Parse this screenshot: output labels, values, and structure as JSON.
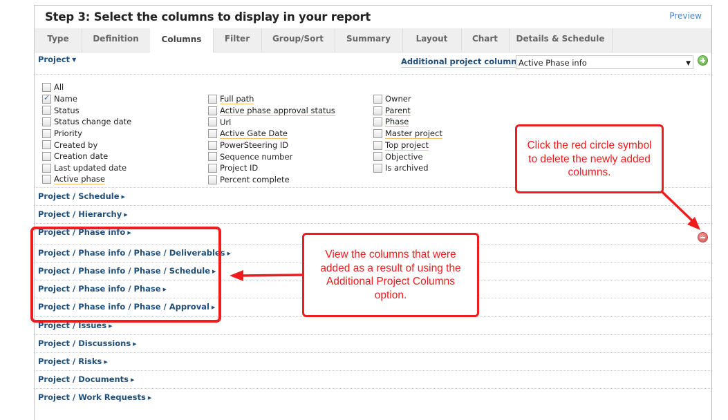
{
  "header": {
    "title": "Step 3: Select the columns to display in your report",
    "preview_label": "Preview"
  },
  "tabs": [
    {
      "label": "Type",
      "active": false
    },
    {
      "label": "Definition",
      "active": false
    },
    {
      "label": "Columns",
      "active": true
    },
    {
      "label": "Filter",
      "active": false
    },
    {
      "label": "Group/Sort",
      "active": false
    },
    {
      "label": "Summary",
      "active": false
    },
    {
      "label": "Layout",
      "active": false
    },
    {
      "label": "Chart",
      "active": false
    },
    {
      "label": "Details & Schedule",
      "active": false
    }
  ],
  "project_section": {
    "label": "Project",
    "additional_columns_label": "Additional project columns :",
    "additional_columns_value": "Active Phase info",
    "add_icon": "plus-circle-icon"
  },
  "checkbox_columns": [
    [
      {
        "label": "All",
        "checked": false,
        "underlined": false
      },
      {
        "label": "Name",
        "checked": true,
        "underlined": false
      },
      {
        "label": "Status",
        "checked": false,
        "underlined": false
      },
      {
        "label": "Status change date",
        "checked": false,
        "underlined": false
      },
      {
        "label": "Priority",
        "checked": false,
        "underlined": false
      },
      {
        "label": "Created by",
        "checked": false,
        "underlined": false
      },
      {
        "label": "Creation date",
        "checked": false,
        "underlined": false
      },
      {
        "label": "Last updated date",
        "checked": false,
        "underlined": false
      },
      {
        "label": "Active phase",
        "checked": false,
        "underlined": true
      }
    ],
    [
      {
        "label": "Full path",
        "checked": false,
        "underlined": true
      },
      {
        "label": "Active phase approval status",
        "checked": false,
        "underlined": true
      },
      {
        "label": "Url",
        "checked": false,
        "underlined": false
      },
      {
        "label": "Active Gate Date",
        "checked": false,
        "underlined": true
      },
      {
        "label": "PowerSteering ID",
        "checked": false,
        "underlined": false
      },
      {
        "label": "Sequence number",
        "checked": false,
        "underlined": false
      },
      {
        "label": "Project ID",
        "checked": false,
        "underlined": false
      },
      {
        "label": "Percent complete",
        "checked": false,
        "underlined": false
      }
    ],
    [
      {
        "label": "Owner",
        "checked": false,
        "underlined": false
      },
      {
        "label": "Parent",
        "checked": false,
        "underlined": true
      },
      {
        "label": "Phase",
        "checked": false,
        "underlined": true
      },
      {
        "label": "Master project",
        "checked": false,
        "underlined": true
      },
      {
        "label": "Top project",
        "checked": false,
        "underlined": true
      },
      {
        "label": "Objective",
        "checked": false,
        "underlined": false
      },
      {
        "label": "Is archived",
        "checked": false,
        "underlined": false
      }
    ]
  ],
  "sections": [
    {
      "label": "Project / Schedule"
    },
    {
      "label": "Project / Hierarchy"
    },
    {
      "label": "Project / Phase info",
      "removable": true
    },
    {
      "label": "Project / Phase info / Phase / Deliverables"
    },
    {
      "label": "Project / Phase info / Phase / Schedule"
    },
    {
      "label": "Project / Phase info / Phase"
    },
    {
      "label": "Project / Phase info / Phase / Approval"
    },
    {
      "label": "Project / Issues"
    },
    {
      "label": "Project / Discussions"
    },
    {
      "label": "Project / Risks"
    },
    {
      "label": "Project / Documents"
    },
    {
      "label": "Project / Work Requests"
    }
  ],
  "annotations": {
    "delete_callout": "Click the red circle symbol to delete the newly added columns.",
    "view_callout": "View the columns that were added as a result of using the Additional Project Columns option.",
    "color": "#ee1c1c"
  }
}
